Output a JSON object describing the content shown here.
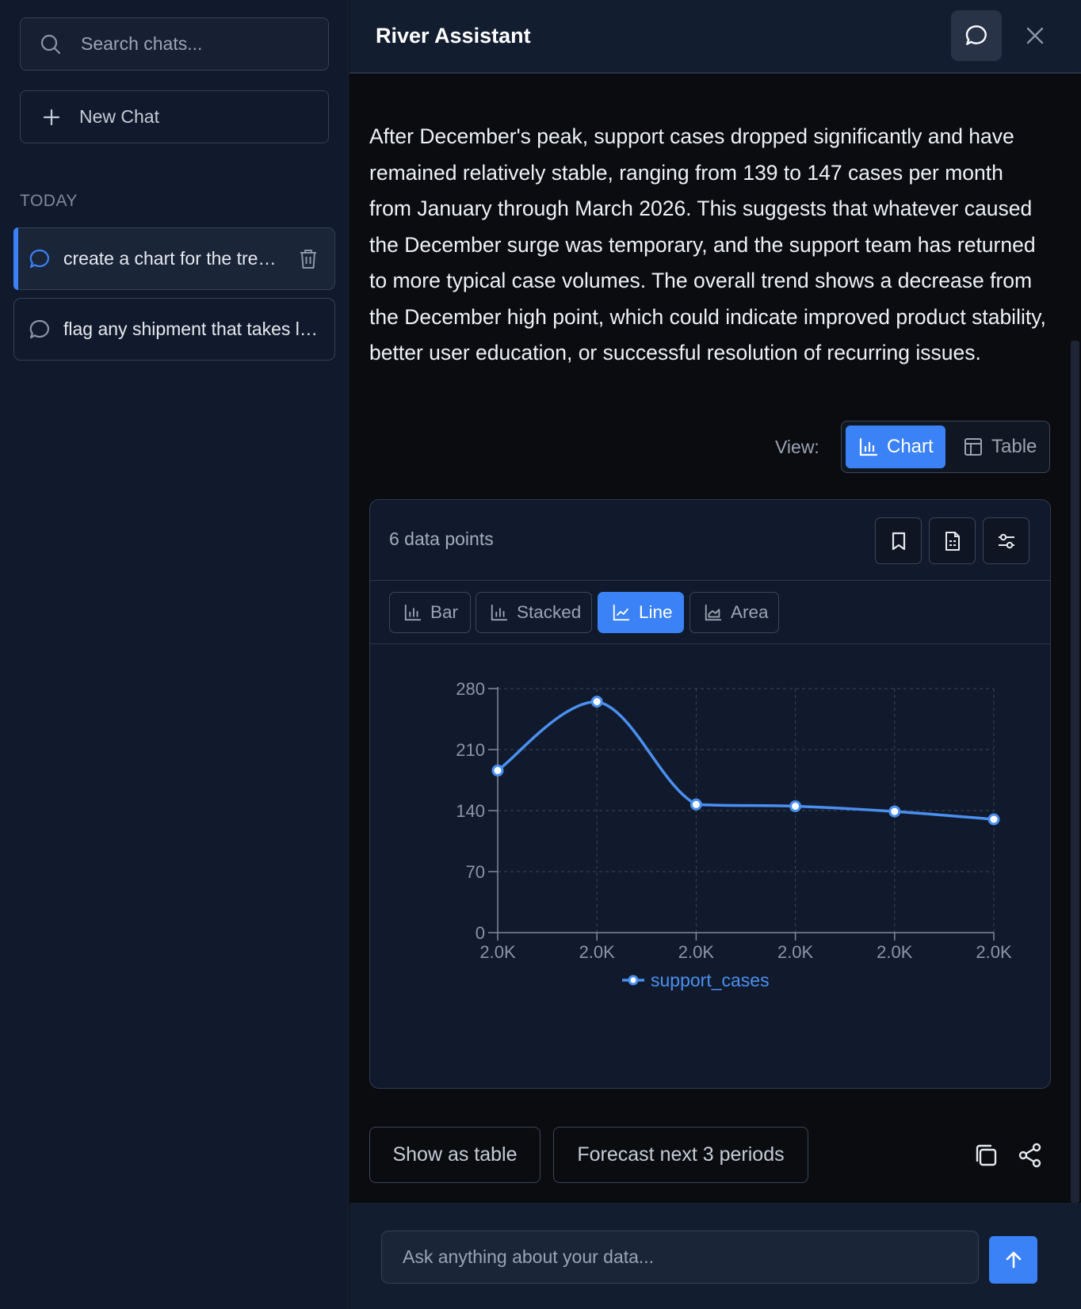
{
  "sidebar": {
    "search_placeholder": "Search chats...",
    "new_chat_label": "New Chat",
    "section_label": "TODAY",
    "chats": [
      {
        "label": "create a chart for the trend of support cases",
        "active": true
      },
      {
        "label": "flag any shipment that takes longer than expected",
        "active": false
      }
    ]
  },
  "header": {
    "title": "River Assistant"
  },
  "message": {
    "text": "After December's peak, support cases dropped significantly and have remained relatively stable, ranging from 139 to 147 cases per month from January through March 2026. This suggests that whatever caused the December surge was temporary, and the support team has returned to more typical case volumes. The overall trend shows a decrease from the December high point, which could indicate improved product stability, better user education, or successful resolution of recurring issues."
  },
  "view": {
    "label": "View:",
    "chart_label": "Chart",
    "table_label": "Table"
  },
  "card": {
    "count_label": "6 data points",
    "types": [
      "Bar",
      "Stacked",
      "Line",
      "Area"
    ],
    "active_type": "Line"
  },
  "chart_data": {
    "type": "line",
    "x_tick_labels": [
      "2.0K",
      "2.0K",
      "2.0K",
      "2.0K",
      "2.0K",
      "2.0K"
    ],
    "y_ticks": [
      0,
      70,
      140,
      210,
      280
    ],
    "ylim": [
      0,
      280
    ],
    "grid": true,
    "legend_position": "bottom-center",
    "series": [
      {
        "name": "support_cases",
        "color": "#4a90f0",
        "values": [
          186,
          265,
          147,
          145,
          139,
          130
        ]
      }
    ]
  },
  "suggestions": [
    "Show as table",
    "Forecast next 3 periods"
  ],
  "input": {
    "placeholder": "Ask anything about your data..."
  },
  "colors": {
    "accent": "#3b82f6",
    "line": "#4a90f0",
    "sidebar_bg": "#111a2c",
    "main_bg": "#0a0c10"
  }
}
